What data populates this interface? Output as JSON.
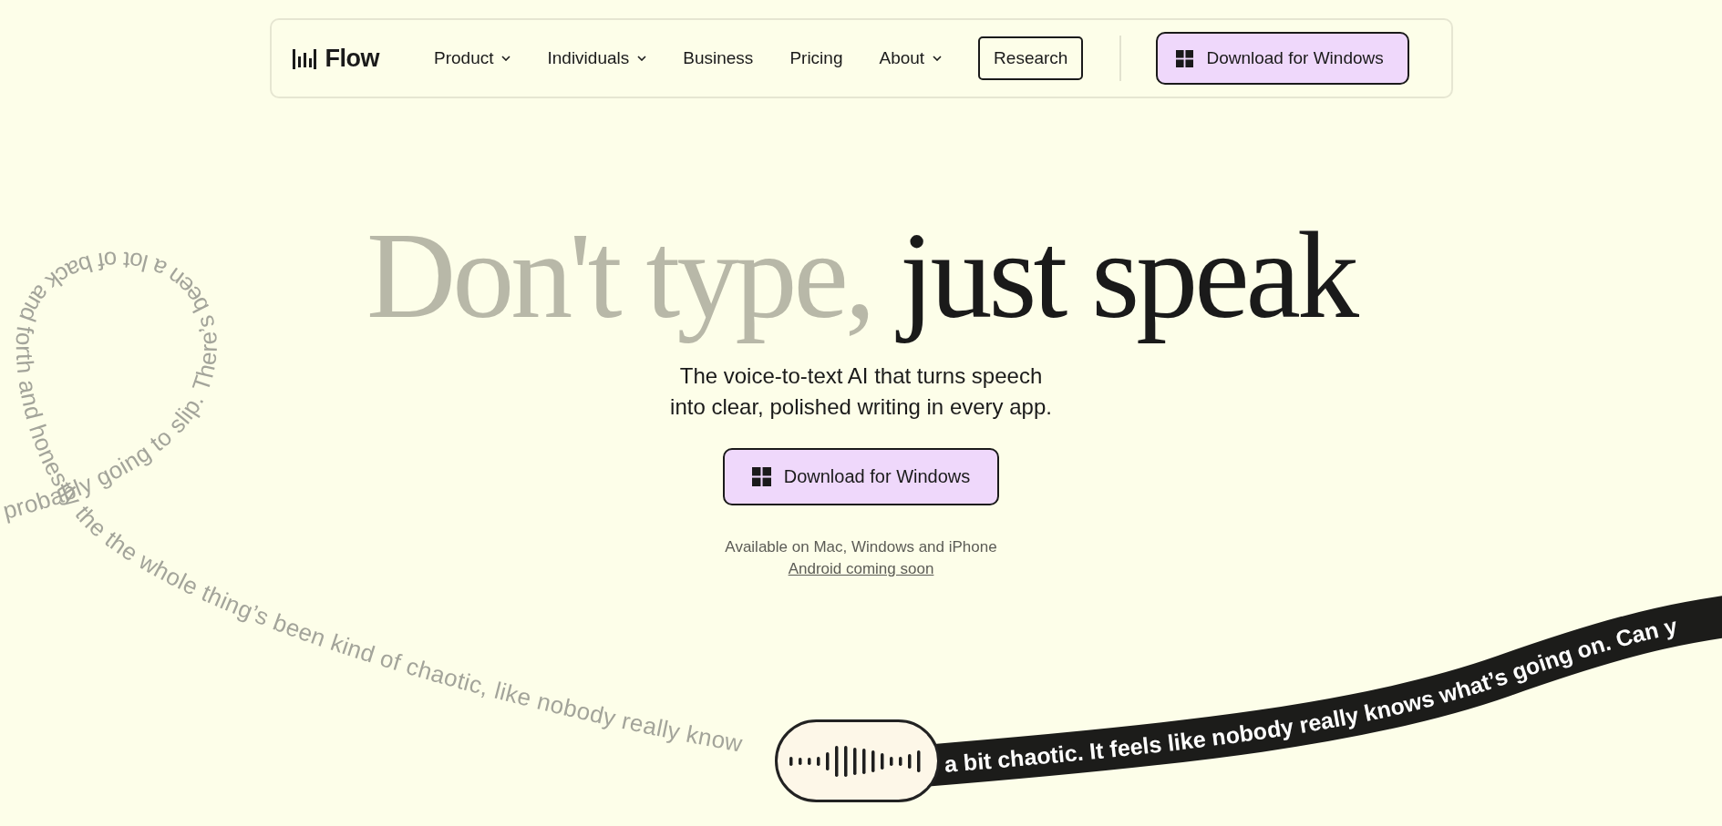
{
  "nav": {
    "logo": "Flow",
    "items": [
      {
        "label": "Product",
        "dropdown": true
      },
      {
        "label": "Individuals",
        "dropdown": true
      },
      {
        "label": "Business",
        "dropdown": false
      },
      {
        "label": "Pricing",
        "dropdown": false
      },
      {
        "label": "About",
        "dropdown": true
      }
    ],
    "research": "Research",
    "download": "Download for Windows"
  },
  "hero": {
    "title_muted": "Don't type,",
    "title_strong": "just speak",
    "subtitle": "The voice-to-text AI that turns speech\ninto clear, polished writing in every app.",
    "cta": "Download for Windows",
    "availability": "Available on Mac, Windows and iPhone",
    "android_link": "Android coming soon"
  },
  "transcript": {
    "spoken": "probably going to slip. There’s been a lot of back and forth and honestly the the whole thing’s been kind of chaotic, like nobody really know",
    "typed": "a bit chaotic. It feels like nobody really knows what’s going on. Can y"
  }
}
